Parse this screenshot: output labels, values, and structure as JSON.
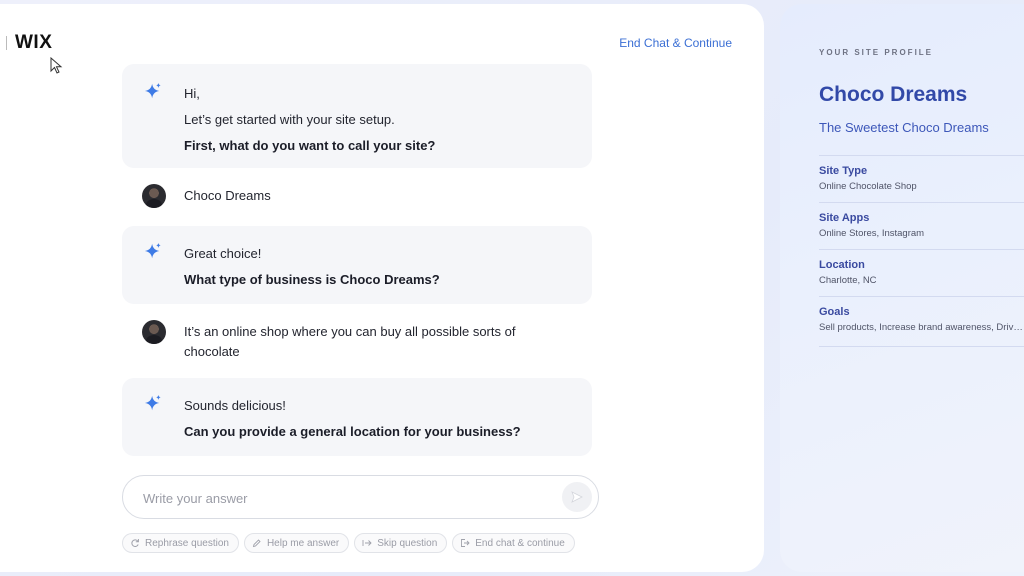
{
  "app": {
    "logo": "WIX",
    "end_chat_link": "End Chat & Continue"
  },
  "chat": {
    "messages": [
      {
        "role": "assistant",
        "lines": [
          "Hi,",
          "Let’s get started with your site setup."
        ],
        "question": "First, what do you want to call your site?"
      },
      {
        "role": "user",
        "text": "Choco Dreams"
      },
      {
        "role": "assistant",
        "lines": [
          "Great choice!"
        ],
        "question": "What type of business is Choco Dreams?"
      },
      {
        "role": "user",
        "lines": [
          "It’s an online shop where you can buy all possible sorts of",
          "chocolate"
        ]
      },
      {
        "role": "assistant",
        "lines": [
          "Sounds delicious!"
        ],
        "question": "Can you provide a general location for your business?"
      }
    ],
    "input": {
      "placeholder": "Write your answer",
      "value": ""
    },
    "chips": [
      {
        "label": "Rephrase question",
        "icon": "refresh-icon"
      },
      {
        "label": "Help me answer",
        "icon": "pencil-sparkle-icon"
      },
      {
        "label": "Skip question",
        "icon": "skip-arrow-icon"
      },
      {
        "label": "End chat & continue",
        "icon": "exit-icon"
      }
    ]
  },
  "profile": {
    "eyebrow": "YOUR SITE PROFILE",
    "site_name": "Choco Dreams",
    "tagline": "The Sweetest Choco Dreams",
    "fields": [
      {
        "label": "Site Type",
        "value": "Online Chocolate Shop"
      },
      {
        "label": "Site Apps",
        "value": "Online Stores, Instagram"
      },
      {
        "label": "Location",
        "value": "Charlotte, NC"
      },
      {
        "label": "Goals",
        "value": "Sell products, Increase brand awareness, Drive traffic"
      }
    ]
  },
  "colors": {
    "accent": "#3b6fd4",
    "profile_title": "#3249a8",
    "bubble_bg": "#f5f6f9"
  }
}
